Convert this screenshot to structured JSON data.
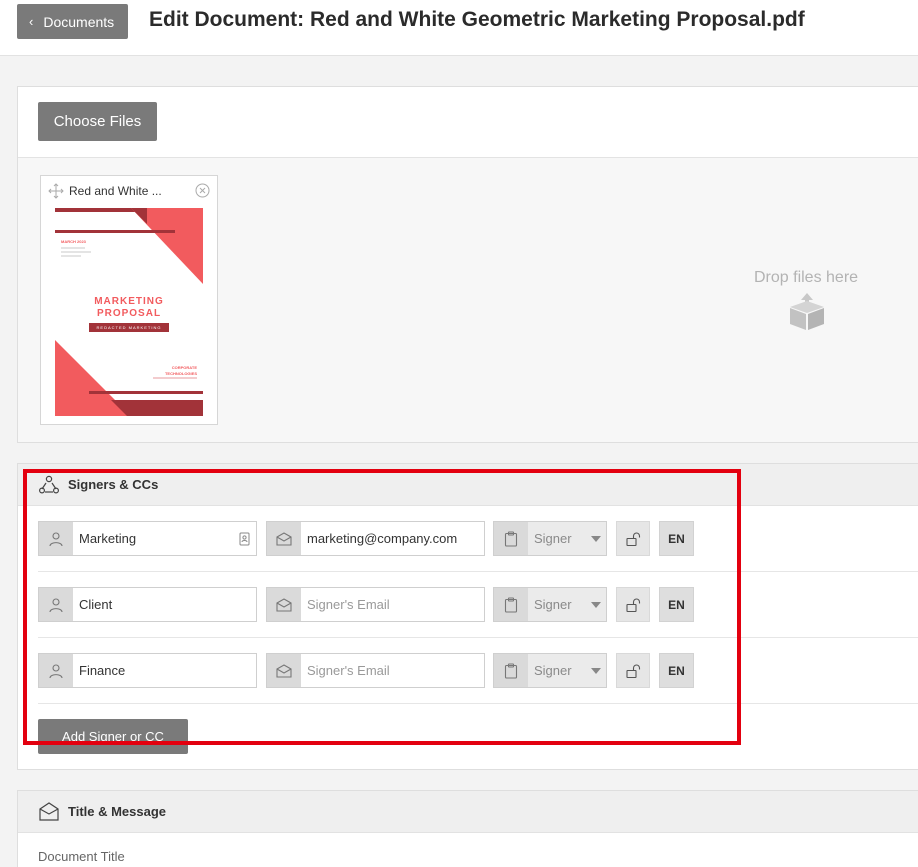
{
  "header": {
    "back_label": "Documents",
    "title": "Edit Document: Red and White Geometric Marketing Proposal.pdf"
  },
  "upload": {
    "choose_files_label": "Choose Files",
    "drop_label": "Drop files here",
    "file": {
      "name": "Red and White ...",
      "thumbnail": {
        "date": "MARCH 2023",
        "line1": "MARKETING",
        "line2": "PROPOSAL",
        "band": "REDACTED MARKETING",
        "org1": "CORPORATE",
        "org2": "TECHNOLOGIES"
      }
    }
  },
  "signers": {
    "heading": "Signers & CCs",
    "rows": [
      {
        "name": "Marketing",
        "email": "marketing@company.com",
        "email_placeholder": "",
        "role": "Signer",
        "lang": "EN"
      },
      {
        "name": "Client",
        "email": "",
        "email_placeholder": "Signer's Email",
        "role": "Signer",
        "lang": "EN"
      },
      {
        "name": "Finance",
        "email": "",
        "email_placeholder": "Signer's Email",
        "role": "Signer",
        "lang": "EN"
      }
    ],
    "add_label": "Add Signer or CC"
  },
  "title_message": {
    "heading": "Title & Message",
    "document_title_label": "Document Title"
  },
  "colors": {
    "accent_button": "#7a7a7a",
    "highlight": "#e3000f",
    "thumbnail_red": "#f25b5e",
    "thumbnail_dark": "#a23339"
  }
}
